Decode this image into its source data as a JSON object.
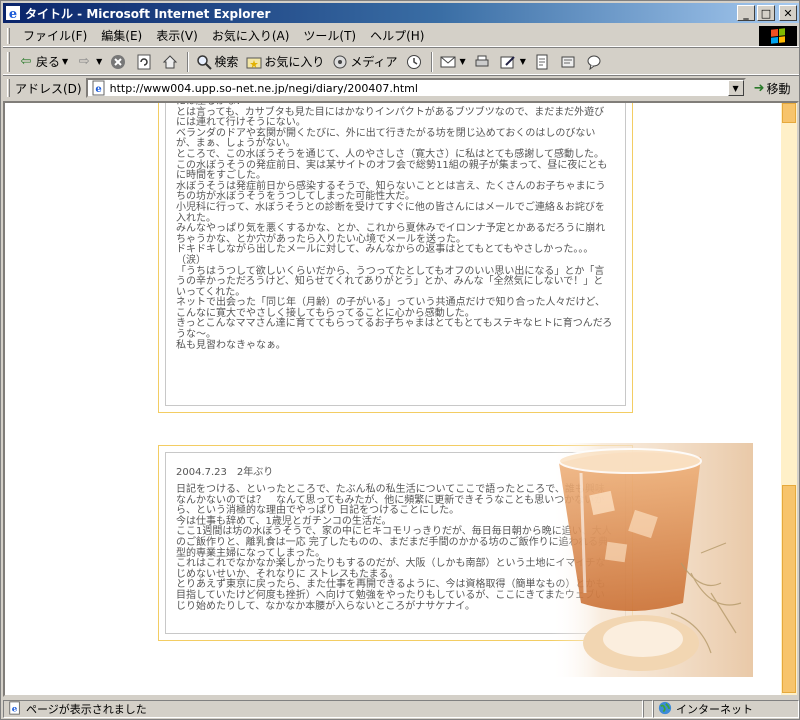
{
  "window": {
    "title": "タイトル - Microsoft Internet Explorer",
    "minimize": "_",
    "maximize": "□",
    "close": "✕"
  },
  "menu": [
    "ファイル(F)",
    "編集(E)",
    "表示(V)",
    "お気に入り(A)",
    "ツール(T)",
    "ヘルプ(H)"
  ],
  "toolbar": {
    "back": "戻る",
    "search": "検索",
    "favorites": "お気に入り",
    "media": "メディア"
  },
  "address": {
    "label": "アドレス(D)",
    "url": "http://www004.upp.so-net.ne.jp/negi/diary/200407.html",
    "go": "移動"
  },
  "entries": [
    {
      "text": "には座るかな？\nとは言っても、カサブタも見た目にはかなりインパクトがあるブツブツなので、まだまだ外遊びには連れて行けそうにない。\nベランダのドアや玄関が開くたびに、外に出て行きたがる坊を閉じ込めておくのはしのびないが、まぁ、しょうがない。\nところで、この水ぼうそうを通じて、人のやさしさ（寛大さ）に私はとても感謝して感動した。\nこの水ぼうそうの発症前日、実は某サイトのオフ会で総勢11組の親子が集まって、昼に夜にともに時間をすごした。\n水ぼうそうは発症前日から感染するそうで、知らないこととは言え、たくさんのお子ちゃまにうちの坊が水ぼうそうをうつしてしまった可能性大だ。\n小児科に行って、水ぼうそうとの診断を受けてすぐに他の皆さんにはメールでご連絡＆お詫びを入れた。\nみんなやっぱり気を悪くするかな、とか、これから夏休みでイロンナ予定とかあるだろうに崩れちゃうかな、とか穴があったら入りたい心境でメールを送った。\nドキドキしながら出したメールに対して、みんなからの返事はとてもとてもやさしかった。。。（涙）\n「うちはうつして欲しいくらいだから、うつってたとしてもオフのいい思い出になる」とか「言うの辛かっただろうけど、知らせてくれてありがとう」とか、みんな「全然気にしないで！」といってくれた。\nネットで出会った「同じ年（月齢）の子がいる」っていう共通点だけで知り合った人々だけど、こんなに寛大でやさしく接してもらってることに心から感動した。\nきっとこんなママさん達に育ててもらってるお子ちゃまはとてもとてもステキなヒトに育つんだろうな〜。\n私も見習わなきゃなぁ。"
    },
    {
      "heading": "2004.7.23　2年ぶり",
      "text": "日記をつける、といったところで、たぶん私の私生活についてここで語ったところで、誰も興味なんかないのでは？　なんて思ってもみたが、他に頻繁に更新できそうなことも思いつかないから、という消極的な理由でやっぱり 日記をつけることにした。\n今は仕事も辞めて、1歳児とガチンコの生活だ。\nここ1週間は坊の水ぼうそうで、家の中にヒキコモリっきりだが、毎日毎日朝から晩に追い、大人のご飯作りと、離乳食は一応 完了したものの、まだまだ手間のかかる坊のご飯作りに追われる典型的専業主婦になってしまった。\nこれはこれでなかなか楽しかったりもするのだが、大阪（しかも南部）という土地にイマイチなじめないせいか、それなりに ストレスもたまる。\nとりあえず東京に戻ったら、また仕事を再開できるように、今は資格取得（簡単なもの）とかも目指していたけど何度も挫折）へ向けて勉強をやったりもしているが、ここにきてまたウェブいじり始めたりして、なかなか本腰が入らないところがナサケナイ。"
    }
  ],
  "status": {
    "message": "ページが表示されました",
    "zone": "インターネット"
  },
  "colors": {
    "entry_border": "#f3cd63",
    "scroll_track": "#fff0c8",
    "scroll_thumb": "#f7c46c",
    "title_gradient_start": "#0a246a",
    "title_gradient_end": "#a6caf0"
  }
}
